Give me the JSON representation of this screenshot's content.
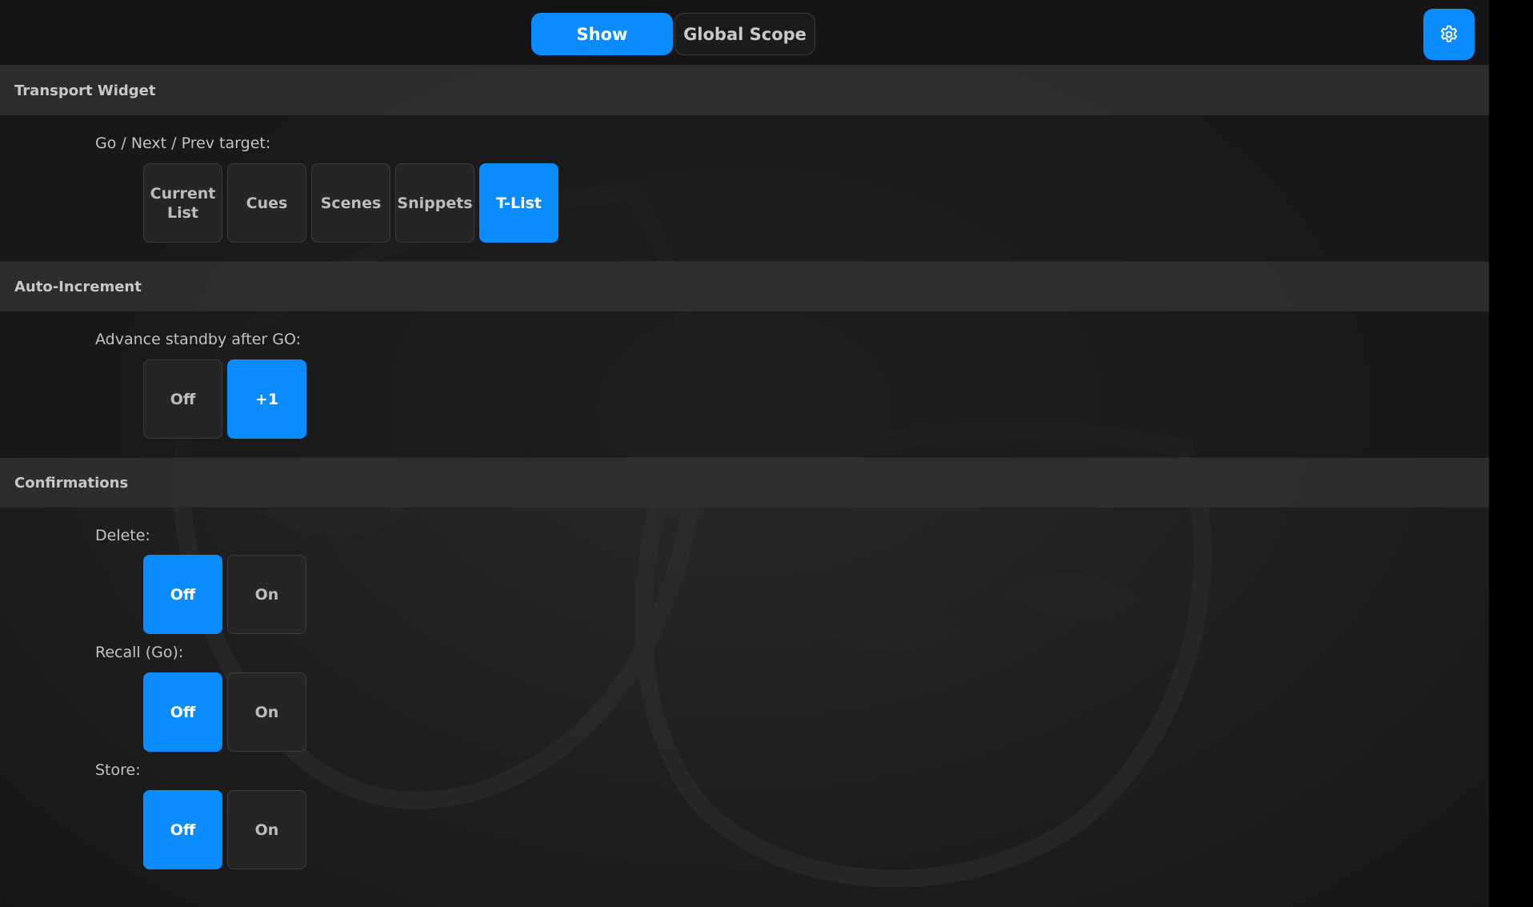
{
  "header": {
    "tabs": [
      {
        "label": "Show",
        "active": true
      },
      {
        "label": "Global Scope",
        "active": false
      }
    ],
    "settings_icon": "gear-icon"
  },
  "colors": {
    "accent": "#0a8cff",
    "background": "#1f1f1f",
    "section_header": "#303030"
  },
  "transport_widget": {
    "title": "Transport Widget",
    "label": "Go / Next / Prev target:",
    "options": [
      "Current List",
      "Cues",
      "Scenes",
      "Snippets",
      "T-List"
    ],
    "selected": "T-List"
  },
  "auto_increment": {
    "title": "Auto-Increment",
    "label": "Advance standby after GO:",
    "options": [
      "Off",
      "+1"
    ],
    "selected": "+1"
  },
  "confirmations": {
    "title": "Confirmations",
    "delete": {
      "label": "Delete:",
      "options": [
        "Off",
        "On"
      ],
      "selected": "Off"
    },
    "recall": {
      "label": "Recall (Go):",
      "options": [
        "Off",
        "On"
      ],
      "selected": "Off"
    },
    "store": {
      "label": "Store:",
      "options": [
        "Off",
        "On"
      ],
      "selected": "Off"
    }
  }
}
